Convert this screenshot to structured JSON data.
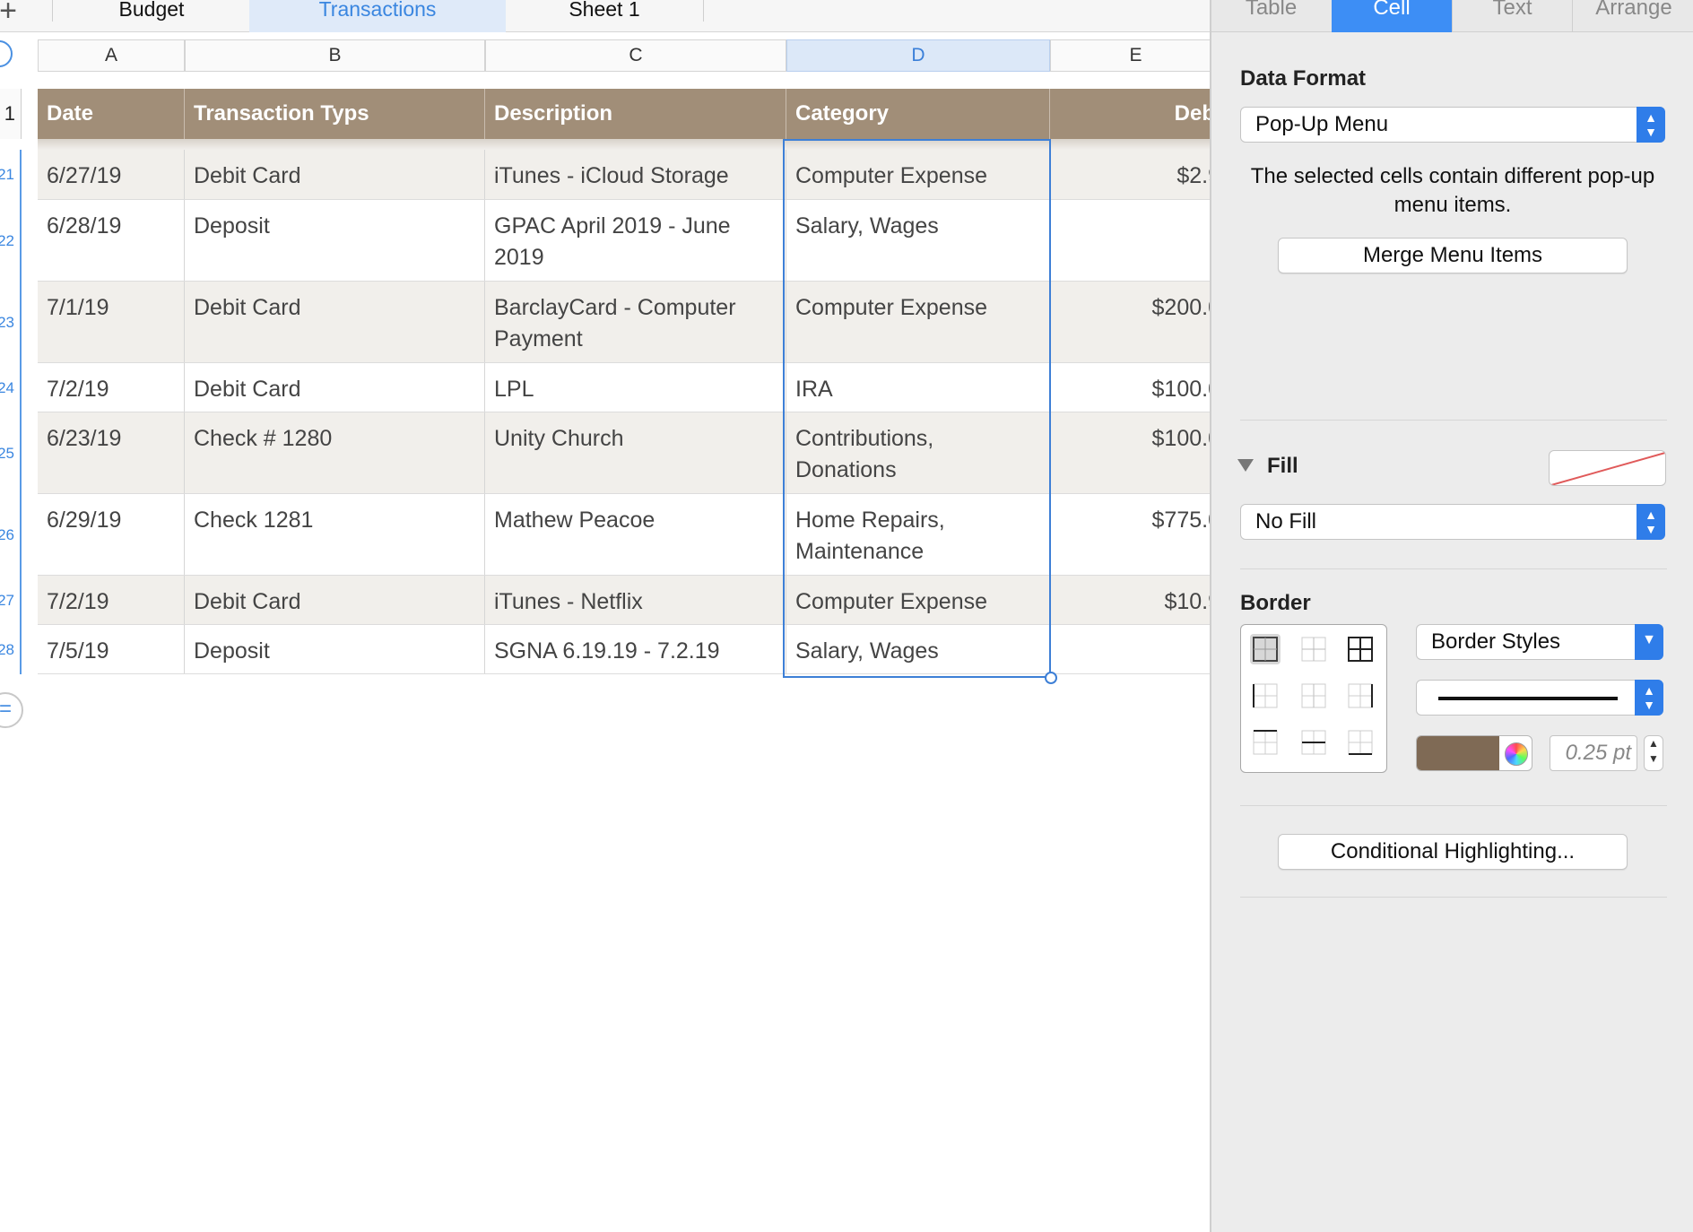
{
  "sheet_tabs": {
    "add_symbol": "+",
    "tabs": [
      {
        "label": "Budget",
        "active": false
      },
      {
        "label": "Transactions",
        "active": true
      },
      {
        "label": "Sheet 1",
        "active": false
      }
    ]
  },
  "columns": [
    "A",
    "B",
    "C",
    "D",
    "E"
  ],
  "selected_column": "D",
  "header_row_number": "1",
  "table": {
    "headers": [
      "Date",
      "Transaction Typs",
      "Description",
      "Category",
      "Deb"
    ],
    "rows": [
      {
        "num": "21",
        "date": "6/27/19",
        "type": "Debit Card",
        "desc": "iTunes - iCloud Storage",
        "cat": "Computer Expense",
        "debit": "$2.9"
      },
      {
        "num": "22",
        "date": "6/28/19",
        "type": "Deposit",
        "desc": "GPAC April 2019 - June 2019",
        "cat": "Salary, Wages",
        "debit": ""
      },
      {
        "num": "23",
        "date": "7/1/19",
        "type": "Debit Card",
        "desc": "BarclayCard - Computer Payment",
        "cat": "Computer Expense",
        "debit": "$200.0"
      },
      {
        "num": "24",
        "date": "7/2/19",
        "type": "Debit Card",
        "desc": "LPL",
        "cat": "IRA",
        "debit": "$100.0"
      },
      {
        "num": "25",
        "date": "6/23/19",
        "type": "Check # 1280",
        "desc": "Unity Church",
        "cat": "Contributions, Donations",
        "debit": "$100.0"
      },
      {
        "num": "26",
        "date": "6/29/19",
        "type": "Check 1281",
        "desc": "Mathew Peacoe",
        "cat": "Home Repairs, Maintenance",
        "debit": "$775.0"
      },
      {
        "num": "27",
        "date": "7/2/19",
        "type": "Debit Card",
        "desc": "iTunes - Netflix",
        "cat": "Computer Expense",
        "debit": "$10.9"
      },
      {
        "num": "28",
        "date": "7/5/19",
        "type": "Deposit",
        "desc": "SGNA  6.19.19 - 7.2.19",
        "cat": "Salary, Wages",
        "debit": ""
      }
    ]
  },
  "inspector": {
    "tabs": [
      {
        "label": "Table",
        "active": false
      },
      {
        "label": "Cell",
        "active": true
      },
      {
        "label": "Text",
        "active": false
      },
      {
        "label": "Arrange",
        "active": false
      }
    ],
    "data_format": {
      "label": "Data Format",
      "value": "Pop-Up Menu",
      "info": "The selected cells contain different pop-up menu items.",
      "merge_button": "Merge Menu Items"
    },
    "fill": {
      "label": "Fill",
      "value": "No Fill"
    },
    "border": {
      "label": "Border",
      "styles_value": "Border Styles",
      "line_color": "#7f6a55",
      "width_value": "0.25 pt"
    },
    "conditional_button": "Conditional Highlighting..."
  },
  "colors": {
    "header_bg": "#a18e78",
    "accent": "#3d8ef5",
    "selection": "#3d7fd6"
  }
}
